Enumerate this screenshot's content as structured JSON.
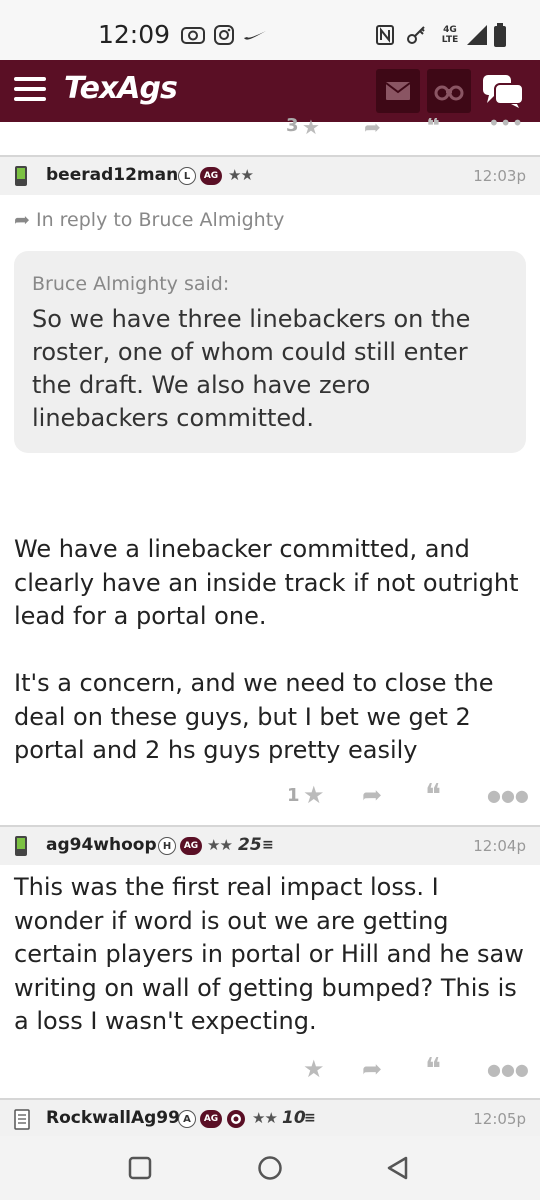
{
  "status_bar": {
    "time": "12:09",
    "network": "4G LTE"
  },
  "header": {
    "logo": "TexAgs"
  },
  "prev_post_actions": {
    "count": "3"
  },
  "posts": [
    {
      "username": "beerad12man",
      "badges": [
        "L",
        "AG"
      ],
      "stars": "★★",
      "timestamp": "12:03p",
      "reply_to": "In reply to Bruce Almighty",
      "quote_header": "Bruce Almighty said:",
      "quote_text": "So we have three linebackers on the roster, one of whom could still enter the draft. We also have zero linebackers committed.",
      "body": "We have a linebacker committed, and clearly have an inside track if not outright lead for a portal one.\n\nIt's a concern, and we need to close the deal on these guys, but I bet we get 2 portal and 2 hs guys pretty easily",
      "like_count": "1"
    },
    {
      "username": "ag94whoop",
      "badges": [
        "H",
        "AG"
      ],
      "stars": "★★",
      "extra": "25",
      "timestamp": "12:04p",
      "body": "This was the first real impact loss. I wonder if word is out we are getting certain players in portal or Hill and he saw writing on wall of getting bumped? This is a loss I wasn't expecting.",
      "like_count": ""
    },
    {
      "username": "RockwallAg99",
      "badges": [
        "A",
        "AG"
      ],
      "stars": "★★",
      "extra": "10",
      "timestamp": "12:05p"
    }
  ],
  "colors": {
    "brand": "#5a0f25",
    "brand_dark": "#3e0816"
  }
}
